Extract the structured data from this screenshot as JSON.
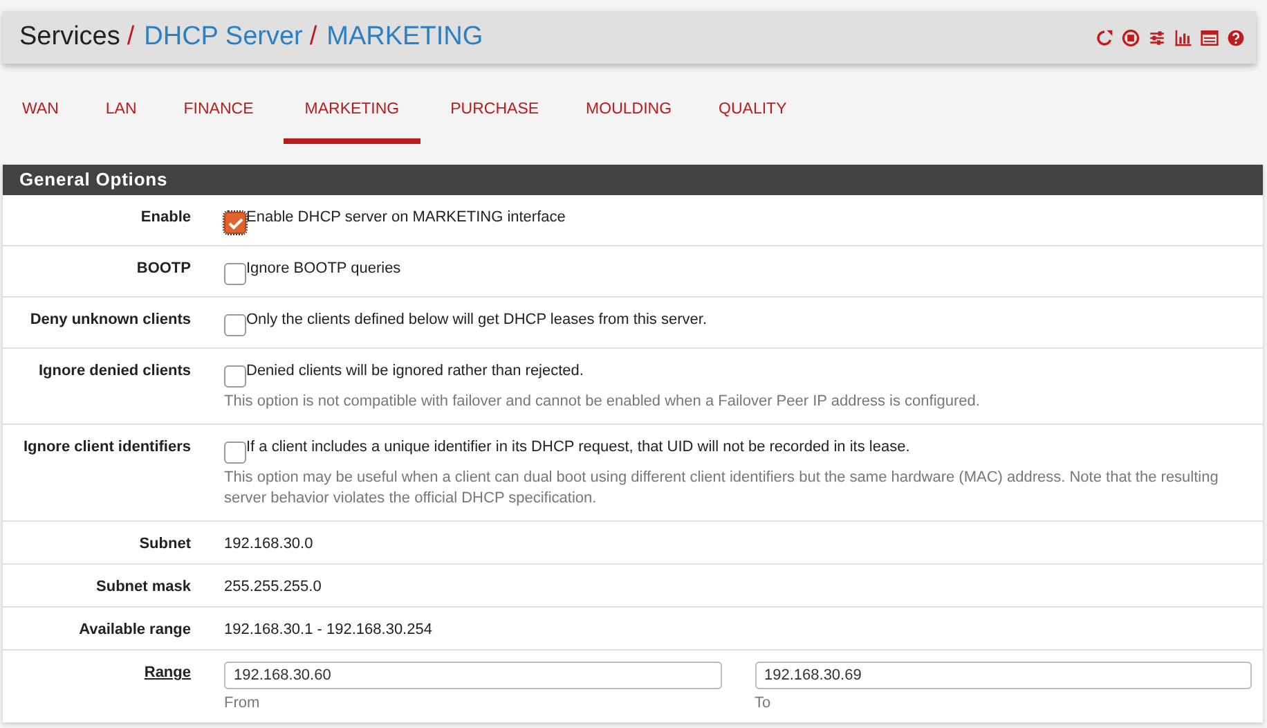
{
  "breadcrumb": [
    {
      "label": "Services",
      "link": false,
      "separator": "/"
    },
    {
      "label": "DHCP Server",
      "link": true,
      "separator": "/"
    },
    {
      "label": "MARKETING",
      "link": true
    }
  ],
  "tabs": [
    {
      "label": "WAN",
      "selected": false
    },
    {
      "label": "LAN",
      "selected": false
    },
    {
      "label": "FINANCE",
      "selected": false
    },
    {
      "label": "MARKETING",
      "selected": true
    },
    {
      "label": "PURCHASE",
      "selected": false
    },
    {
      "label": "MOULDING",
      "selected": false
    },
    {
      "label": "QUALITY",
      "selected": false
    }
  ],
  "panel": {
    "title": "General Options",
    "rows": [
      {
        "kind": "checkbox",
        "label": "Enable",
        "checked": true,
        "text": "Enable DHCP server on MARKETING interface"
      },
      {
        "kind": "checkbox",
        "label": "BOOTP",
        "checked": false,
        "text": "Ignore BOOTP queries"
      },
      {
        "kind": "checkbox",
        "label": "Deny unknown clients",
        "checked": false,
        "text": "Only the clients defined below will get DHCP leases from this server."
      },
      {
        "kind": "checkbox",
        "label": "Ignore denied clients",
        "checked": false,
        "text": "Denied clients will be ignored rather than rejected.",
        "help": "This option is not compatible with failover and cannot be enabled when a Failover Peer IP address is configured."
      },
      {
        "kind": "checkbox",
        "label": "Ignore client identifiers",
        "checked": false,
        "text": "If a client includes a unique identifier in its DHCP request, that UID will not be recorded in its lease.",
        "help": "This option may be useful when a client can dual boot using different client identifiers but the same hardware (MAC) address. Note that the resulting server behavior violates the official DHCP specification."
      },
      {
        "kind": "text",
        "label": "Subnet",
        "text": "192.168.30.0"
      },
      {
        "kind": "text",
        "label": "Subnet mask",
        "text": "255.255.255.0"
      },
      {
        "kind": "text",
        "label": "Available range",
        "text": "192.168.30.1 - 192.168.30.254"
      },
      {
        "kind": "range",
        "label": "Range",
        "from": {
          "value": "192.168.30.60",
          "caption": "From"
        },
        "to": {
          "value": "192.168.30.69",
          "caption": "To"
        }
      }
    ]
  }
}
